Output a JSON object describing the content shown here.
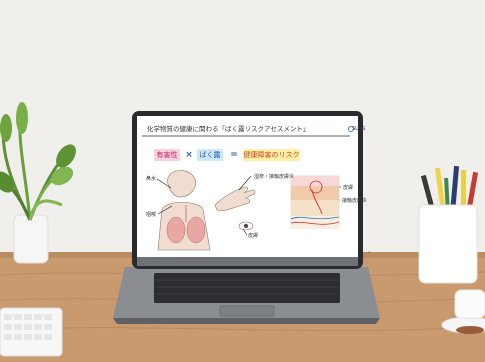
{
  "slide": {
    "title": "化学物質の健康に関わる「ばく露リスクアセスメント」",
    "logo": "SUSS",
    "hazard_label": "有害性",
    "operator_multiply": "×",
    "exposure_label": "ばく露",
    "operator_equals": "=",
    "result_label": "健康障害のリスク",
    "label_nose": "鼻水",
    "label_throat": "咽喉",
    "label_arm": "湿疹・接触皮膚炎",
    "label_skin": "皮膚",
    "label_photo_1": "皮膚",
    "label_photo_2": "接触皮膚炎",
    "page_number": "4"
  },
  "colors": {
    "wall": "#f0efec",
    "desk": "#c89a6e",
    "laptop_body": "#7c7f84",
    "screen_bezel": "#2a2b2e"
  },
  "icons": {
    "plant": "potted-plant-icon",
    "pencil_cup": "pencil-cup-icon",
    "coffee_cup": "coffee-cup-icon",
    "keyboard": "keyboard-icon"
  }
}
